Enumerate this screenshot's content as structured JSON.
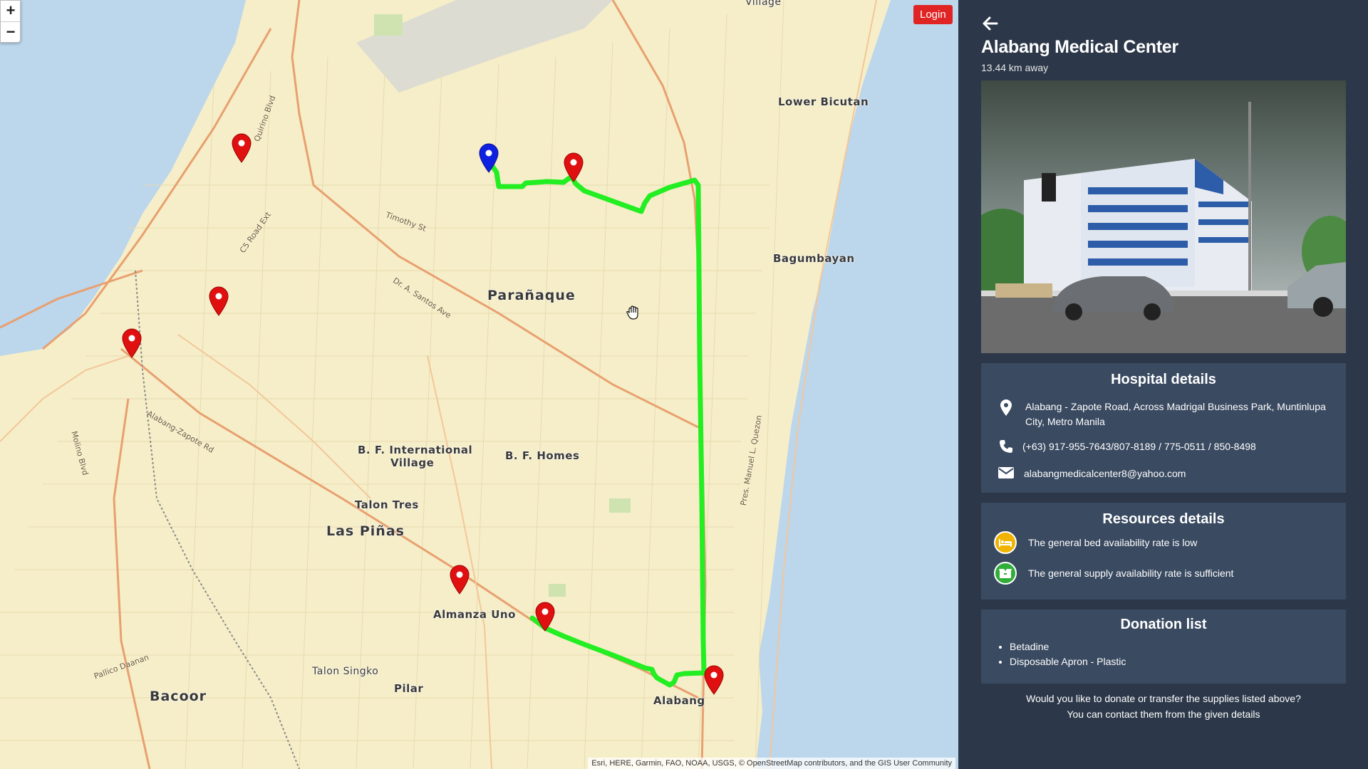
{
  "map": {
    "zoom_in": "+",
    "zoom_out": "−",
    "login_label": "Login",
    "attribution": "Esri, HERE, Garmin, FAO, NOAA, USGS, © OpenStreetMap contributors, and the GIS User Community",
    "places": {
      "village": "Village",
      "lower_bicutan": "Lower Bicutan",
      "bagumbayan": "Bagumbayan",
      "paranaque": "Parañaque",
      "bf_international_1": "B. F. International",
      "bf_international_2": "Village",
      "bf_homes": "B. F. Homes",
      "talon_tres": "Talon Tres",
      "las_pinas": "Las Piñas",
      "almanza_uno": "Almanza Uno",
      "talon_singko": "Talon Singko",
      "pilar": "Pilar",
      "bacoor": "Bacoor",
      "alabang": "Alabang"
    },
    "roads": {
      "quirino": "Quirino Blvd",
      "santos": "Dr. A. Santos Ave",
      "zapote": "Alabang-Zapote Rd",
      "timothy": "Timothy St",
      "molino": "Molino Blvd",
      "marcos": "Pres. Manuel L. Quezon",
      "daanan": "Pallico Daanan",
      "c5": "C5 Road Ext"
    },
    "route_color": "#22ee22",
    "pin_color_hospital": "#e01010",
    "pin_color_user": "#1020e0"
  },
  "panel": {
    "hospital_name": "Alabang Medical Center",
    "distance": "13.44 km away",
    "details_title": "Hospital details",
    "address": "Alabang - Zapote Road, Across Madrigal Business Park, Muntinlupa City, Metro Manila",
    "phone": "(+63) 917-955-7643/807-8189 / 775-0511 / 850-8498",
    "email": "alabangmedicalcenter8@yahoo.com",
    "resources_title": "Resources details",
    "bed_status": "The general bed availability rate is low",
    "supply_status": "The general supply availability rate is sufficient",
    "bed_color": "#f0b400",
    "supply_color": "#2fae3a",
    "donation_title": "Donation list",
    "donations": [
      "Betadine",
      "Disposable Apron - Plastic"
    ],
    "footer_line1": "Would you like to donate or transfer the supplies listed above?",
    "footer_line2": "You can contact them from the given details"
  }
}
